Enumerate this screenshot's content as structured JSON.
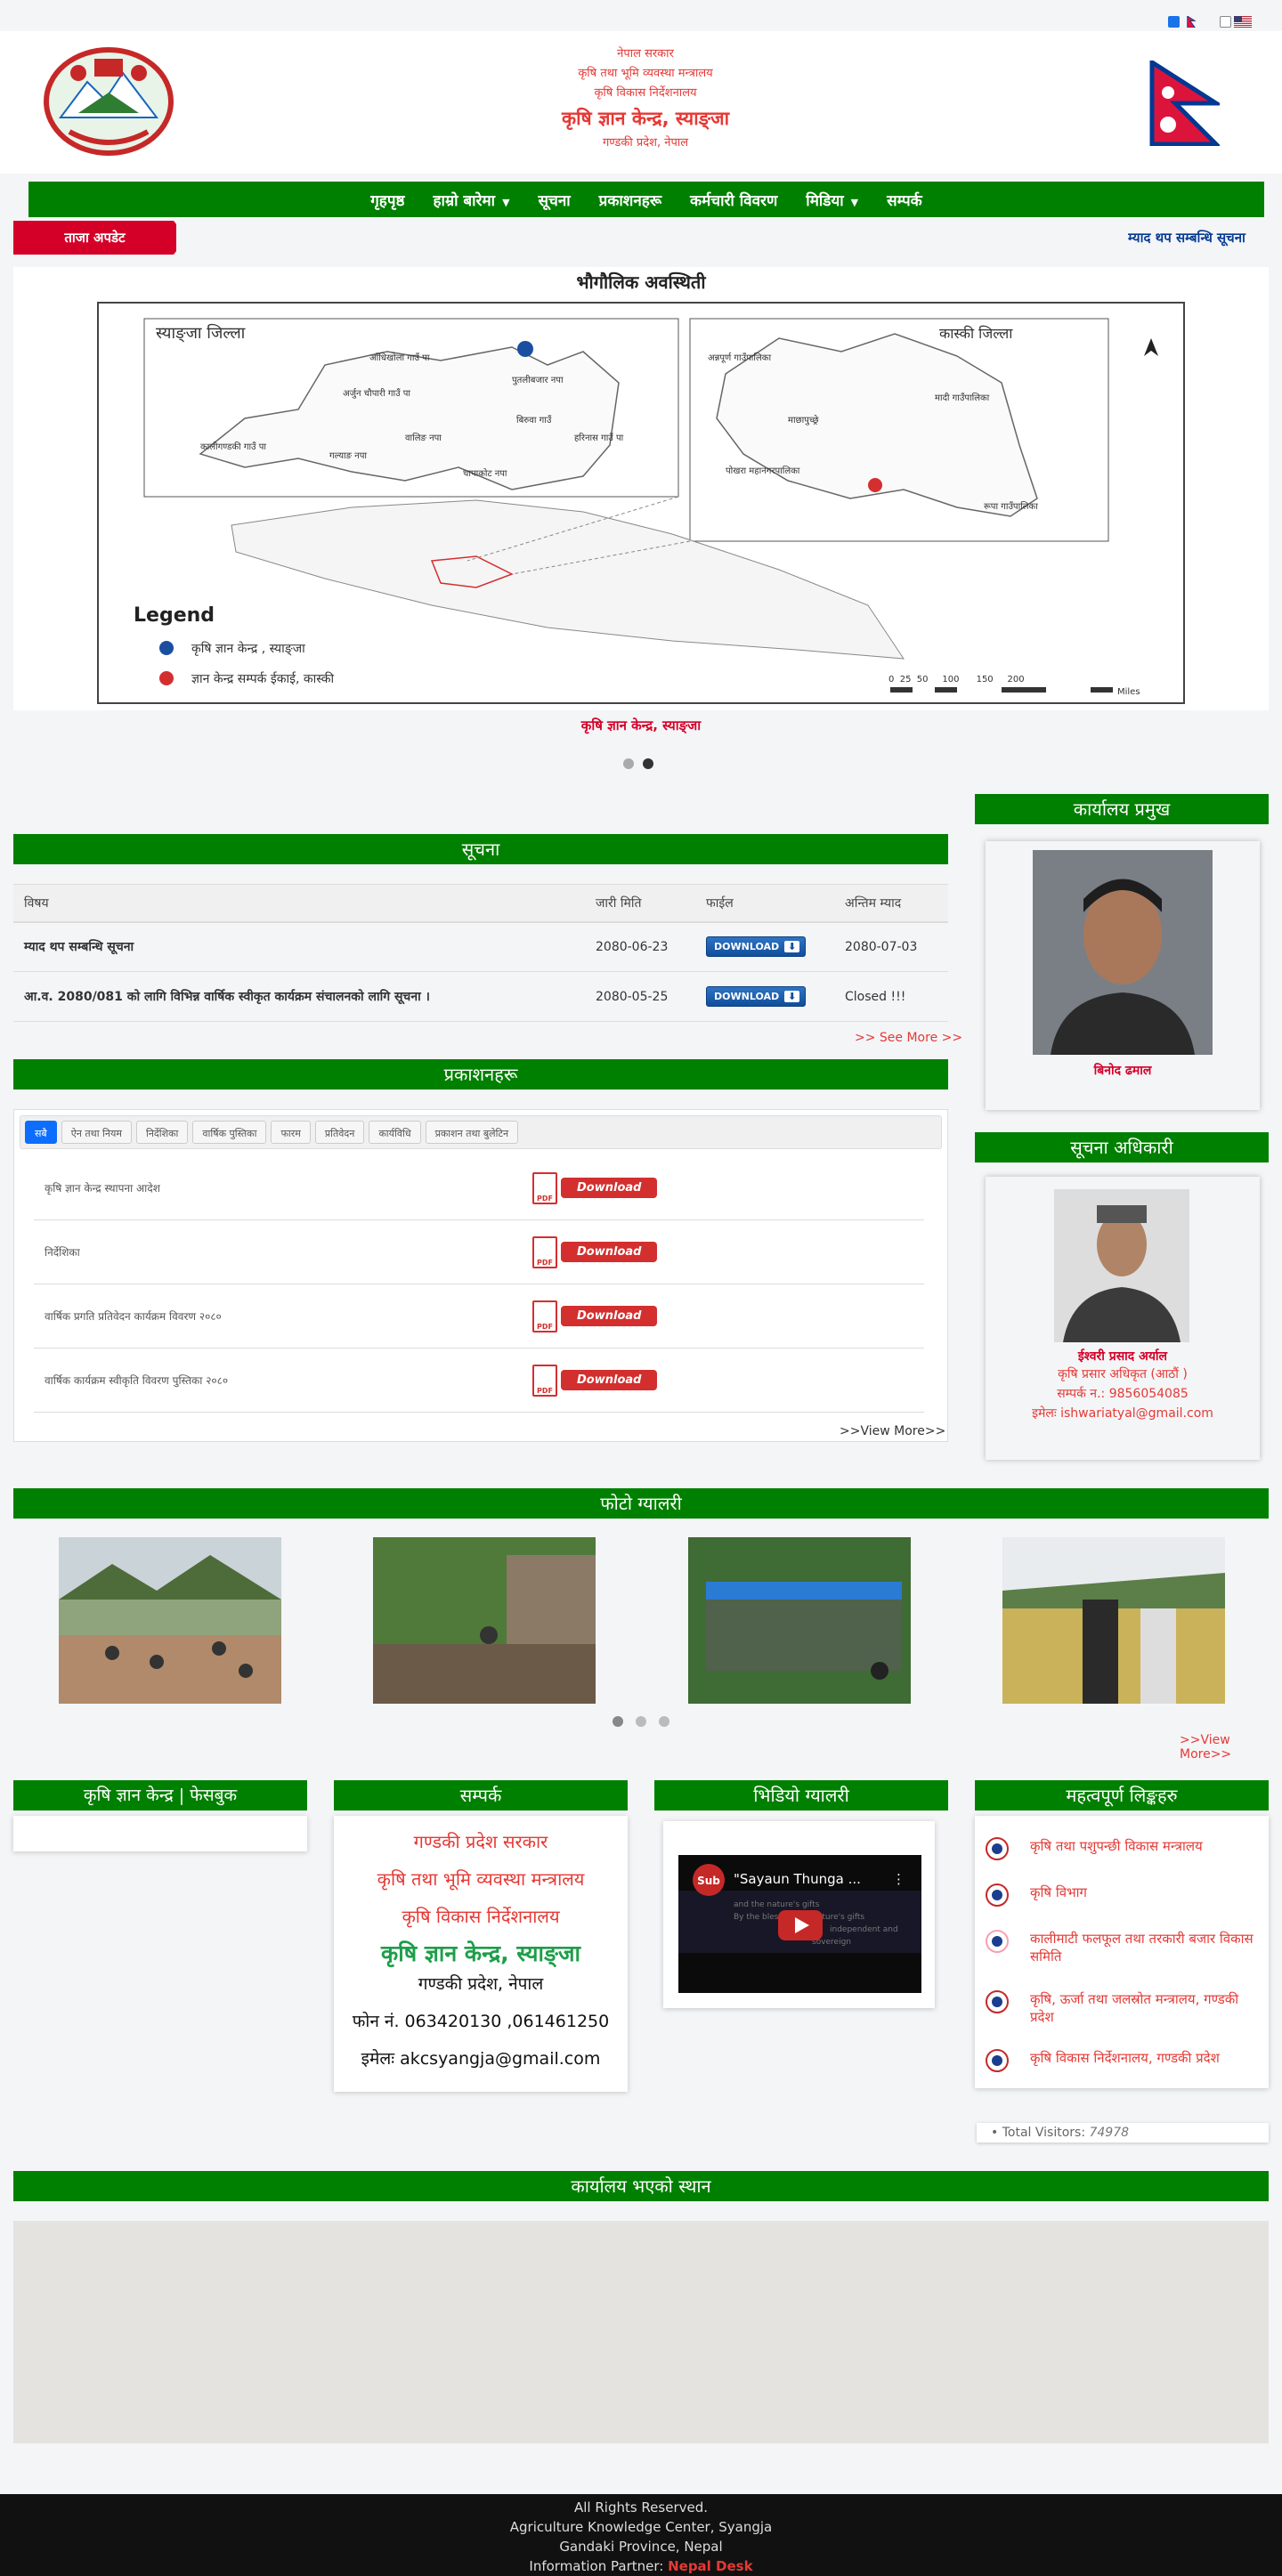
{
  "lang": {
    "en": "English"
  },
  "header": {
    "line1": "नेपाल सरकार",
    "line2": "कृषि तथा भूमि व्यवस्था मन्त्रालय",
    "line3": "कृषि विकास निर्देशनालय",
    "title": "कृषि ज्ञान केन्द्र, स्याङ्जा",
    "address": "गण्डकी प्रदेश, नेपाल"
  },
  "nav": {
    "items": [
      "गृहपृष्ठ",
      "हाम्रो बारेमा",
      "सूचना",
      "प्रकाशनहरू",
      "कर्मचारी विवरण",
      "मिडिया",
      "सम्पर्क"
    ]
  },
  "ticker": {
    "label": "ताजा अपडेट",
    "text": "म्याद थप सम्बन्धि सूचना"
  },
  "slider": {
    "map_title": "भौगौलिक अवस्थिती",
    "district_label": "स्याङ्जा जिल्ला",
    "kaski_label": "कास्की जिल्ला",
    "legend_title": "Legend",
    "legend1": "कृषि ज्ञान केन्द्र , स्याङ्जा",
    "legend2": "ज्ञान केन्द्र सम्पर्क ईकाई, कास्की",
    "scale": "0  25  50     100      150     200",
    "miles": "Miles",
    "places": [
      "आँधिखोला गाउँ पा",
      "पुतलीबजार नपा",
      "अर्जुन चौपारी गाउँ पा",
      "बिरुवा गाउँ",
      "हरिनास गाउँ पा",
      "कालीगण्डकी गाउँ पा",
      "वालिङ नपा",
      "चापाकोट नपा",
      "गल्याङ नपा",
      "अन्नपूर्ण गाउँपालिका",
      "माछापुच्छ्रे",
      "मादी गाउँपालिका",
      "पोखरा महानगरपालिका",
      "रूपा गाउँपालिका"
    ],
    "caption": "कृषि ज्ञान केन्द्र, स्याङ्जा"
  },
  "notice": {
    "heading": "सूचना",
    "columns": [
      "विषय",
      "जारी मिति",
      "फाईल",
      "अन्तिम म्याद"
    ],
    "rows": [
      {
        "subject": "म्याद थप सम्बन्धि सूचना",
        "date": "2080-06-23",
        "file": "DOWNLOAD",
        "deadline": "2080-07-03"
      },
      {
        "subject": "आ.व. 2080/081 को लागि विभिन्न वार्षिक स्वीकृत कार्यक्रम संचालनको लागि सूचना ।",
        "date": "2080-05-25",
        "file": "DOWNLOAD",
        "deadline": "Closed !!!"
      }
    ],
    "see_more": ">> See More >>"
  },
  "publications": {
    "heading": "प्रकाशनहरू",
    "tabs": [
      "सबै",
      "ऐन तथा नियम",
      "निर्देशिका",
      "वार्षिक पुस्तिका",
      "फारम",
      "प्रतिवेदन",
      "कार्यविधि",
      "प्रकाशन तथा बुलेटिन"
    ],
    "items": [
      "कृषि ज्ञान केन्द्र स्थापना आदेश",
      "निर्देशिका",
      "वार्षिक प्रगति प्रतिवेदन कार्यक्रम विवरण २०८०",
      "वार्षिक कार्यक्रम स्वीकृति विवरण पुस्तिका २०८०"
    ],
    "pdf_label": "PDF",
    "download_label": "Download",
    "view_more": ">>View More>>"
  },
  "office_head": {
    "heading": "कार्यालय प्रमुख",
    "name": "बिनोद ढमाल"
  },
  "info_officer": {
    "heading": "सूचना अधिकारी",
    "name": "ईश्वरी प्रसाद अर्याल",
    "post": "कृषि प्रसार अधिकृत (आठौं )",
    "phone": "सम्पर्क न.: 9856054085",
    "email": "इमेलः ishwariatyal@gmail.com"
  },
  "gallery": {
    "heading": "फोटो ग्यालरी",
    "view_more": ">>View More>>"
  },
  "facebook": {
    "heading": "कृषि ज्ञान केन्द्र | फेसबुक"
  },
  "contact": {
    "heading": "सम्पर्क",
    "l1": "गण्डकी प्रदेश सरकार",
    "l2": "कृषि तथा भूमि व्यवस्था मन्त्रालय",
    "l3": "कृषि विकास निर्देशनालय",
    "l4": "कृषि ज्ञान केन्द्र, स्याङ्जा",
    "l5": "गण्डकी प्रदेश, नेपाल",
    "phone": "फोन नं. 063420130 ,061461250",
    "email": "इमेलः akcsyangja@gmail.com"
  },
  "video": {
    "heading": "भिडियो ग्यालरी",
    "badge": "Sub",
    "title": "\"Sayaun Thunga ...",
    "line1": "and the nature's gifts",
    "line2": "By the blessings of nature's gifts",
    "line3": "independent and",
    "line4": "sovereign"
  },
  "links": {
    "heading": "महत्वपूर्ण लिङ्कहरु",
    "items": [
      "कृषि तथा पशुपन्छी विकास मन्त्रालय",
      "कृषि विभाग",
      "कालीमाटी फलफूल तथा तरकारी बजार विकास समिति",
      "कृषि, ऊर्जा तथा जलस्रोत मन्त्रालय, गण्डकी प्रदेश",
      "कृषि विकास निर्देशनालय, गण्डकी प्रदेश"
    ]
  },
  "visitors": {
    "label": "Total Visitors:",
    "count": "74978"
  },
  "map": {
    "heading": "कार्यालय भएको स्थान"
  },
  "footer": {
    "l1": "All Rights Reserved.",
    "l2": "Agriculture Knowledge Center, Syangja",
    "l3": "Gandaki Province, Nepal",
    "l4": "Information Partner:",
    "partner": "Nepal Desk"
  },
  "colors": {
    "green": "#008000",
    "red": "#d50028",
    "blue": "#083d92"
  }
}
